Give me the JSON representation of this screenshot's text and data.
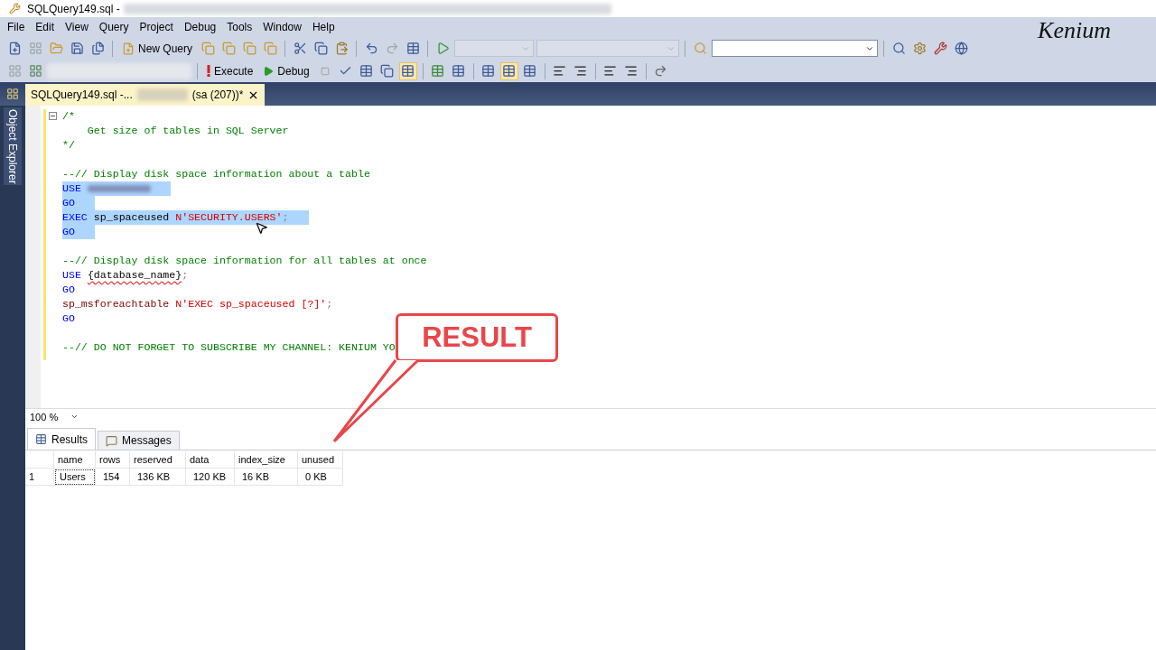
{
  "window": {
    "title": "SQLQuery149.sql -"
  },
  "menu": [
    "File",
    "Edit",
    "View",
    "Query",
    "Project",
    "Debug",
    "Tools",
    "Window",
    "Help"
  ],
  "toolbar": {
    "new_query": "New Query",
    "execute": "Execute",
    "debug": "Debug"
  },
  "logo": "Kenium",
  "document_tab": {
    "title": "SQLQuery149.sql -...",
    "connection": "(sa (207))*",
    "selected": true
  },
  "side_panel": {
    "label": "Object Explorer"
  },
  "editor": {
    "lines": [
      {
        "selected": false,
        "fold": true,
        "tokens": [
          {
            "kind": "comment",
            "text": "/*"
          }
        ]
      },
      {
        "selected": false,
        "tokens": [
          {
            "kind": "comment",
            "text": "    Get size of tables in SQL Server"
          }
        ]
      },
      {
        "selected": false,
        "tokens": [
          {
            "kind": "comment",
            "text": "*/"
          }
        ]
      },
      {
        "selected": false
      },
      {
        "selected": false,
        "tokens": [
          {
            "kind": "comment",
            "text": "--// Display disk space information about a table"
          }
        ]
      },
      {
        "selected": true,
        "tokens": [
          {
            "kind": "keyword",
            "text": "USE"
          },
          {
            "kind": "redacted"
          }
        ]
      },
      {
        "selected": true,
        "tokens": [
          {
            "kind": "keyword",
            "text": "GO"
          }
        ]
      },
      {
        "selected": true,
        "tokens": [
          {
            "kind": "keyword",
            "text": "EXEC"
          },
          {
            "kind": "plain",
            "text": " sp_spaceused "
          },
          {
            "kind": "string",
            "text": "N'SECURITY.USERS'"
          },
          {
            "kind": "punct",
            "text": ";"
          }
        ]
      },
      {
        "selected": true,
        "tokens": [
          {
            "kind": "keyword",
            "text": "GO"
          }
        ]
      },
      {
        "selected": false
      },
      {
        "selected": false,
        "tokens": [
          {
            "kind": "comment",
            "text": "--// Display disk space information for all tables at once"
          }
        ]
      },
      {
        "selected": false,
        "tokens": [
          {
            "kind": "keyword",
            "text": "USE"
          },
          {
            "kind": "error",
            "text": "{database_name}"
          },
          {
            "kind": "punct",
            "text": ";"
          }
        ]
      },
      {
        "selected": false,
        "tokens": [
          {
            "kind": "keyword",
            "text": "GO"
          }
        ]
      },
      {
        "selected": false,
        "tokens": [
          {
            "kind": "system",
            "text": "sp_msforeachtable"
          },
          {
            "kind": "string",
            "text": "N'EXEC sp_spaceused [?]'"
          },
          {
            "kind": "punct",
            "text": ";"
          }
        ]
      },
      {
        "selected": false,
        "tokens": [
          {
            "kind": "keyword",
            "text": "GO"
          }
        ]
      },
      {
        "selected": false
      },
      {
        "selected": false,
        "tokens": [
          {
            "kind": "comment",
            "text": "--// DO NOT FORGET TO SUBSCRIBE MY CHANNEL: KENIUM YO"
          }
        ]
      }
    ]
  },
  "callout": "RESULT",
  "zoom": "100 %",
  "result_tabs": [
    {
      "label": "Results",
      "selected": true
    },
    {
      "label": "Messages",
      "selected": false
    }
  ],
  "results": {
    "columns": [
      "name",
      "rows",
      "reserved",
      "data",
      "index_size",
      "unused"
    ],
    "rows": [
      {
        "number": "1",
        "cells": [
          "Users",
          "154",
          "136 KB",
          "120 KB",
          "16 KB",
          "0 KB"
        ]
      }
    ]
  }
}
